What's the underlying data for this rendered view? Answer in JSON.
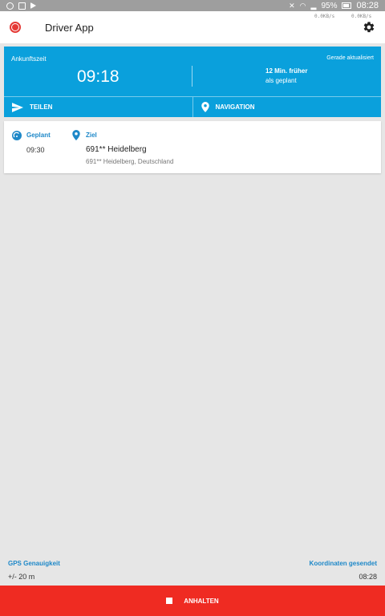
{
  "status_bar": {
    "battery": "95%",
    "time": "08:28"
  },
  "app_bar": {
    "title": "Driver App",
    "net_down": "0.0KB/s",
    "net_up": "0.0KB/s"
  },
  "arrival": {
    "label": "Ankunftszeit",
    "updated": "Gerade aktualisiert",
    "time": "09:18",
    "diff": "12 Min. früher",
    "diff_sub": "als geplant",
    "share_label": "TEILEN",
    "navigation_label": "NAVIGATION"
  },
  "stop": {
    "planned_label": "Geplant",
    "planned_time": "09:30",
    "destination_label": "Ziel",
    "address_line1": "691** Heidelberg",
    "address_line2": "691** Heidelberg, Deutschland"
  },
  "footer": {
    "gps_label": "GPS Genauigkeit",
    "gps_value": "+/- 20 m",
    "coord_label": "Koordinaten gesendet",
    "coord_value": "08:28"
  },
  "stop_button": {
    "label": "ANHALTEN"
  },
  "colors": {
    "accent": "#0aa0dc",
    "link": "#1e88c8",
    "danger": "#ef2b22"
  }
}
